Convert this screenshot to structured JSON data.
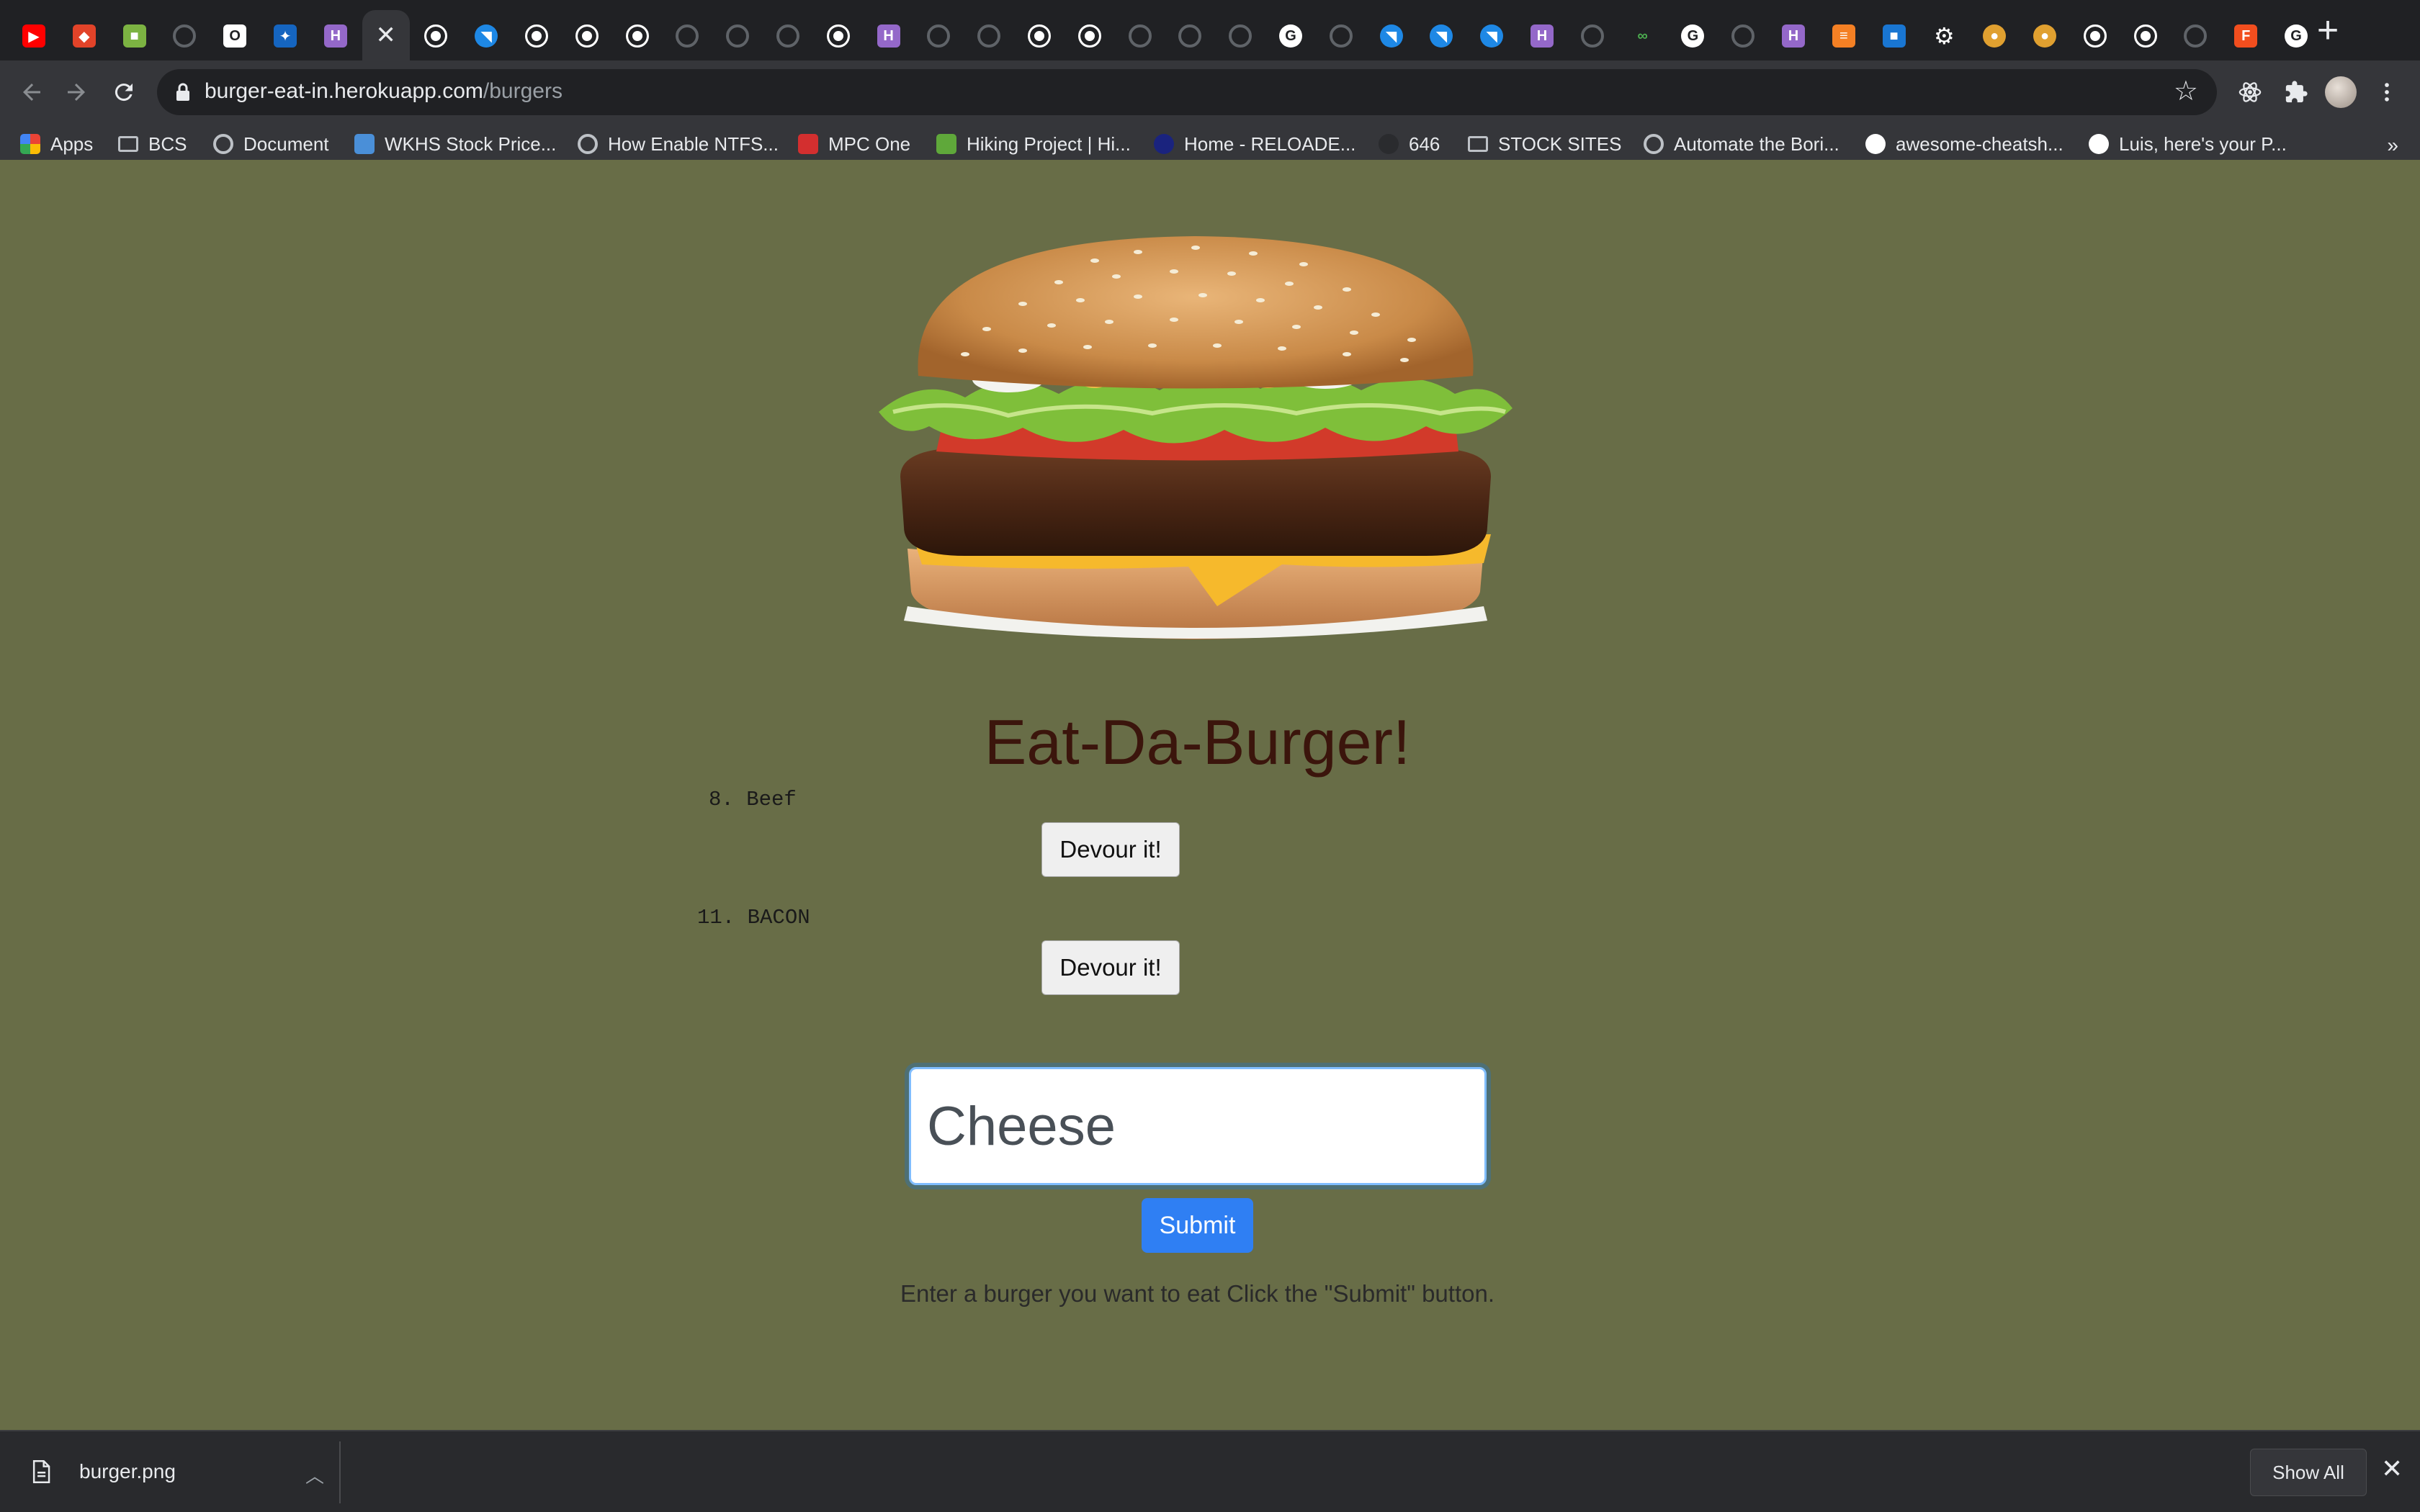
{
  "browser": {
    "tabs": [
      {
        "icon": "youtube-icon",
        "color": "#ff0000"
      },
      {
        "icon": "gitlab-icon",
        "color": "#e24329"
      },
      {
        "icon": "cube-icon",
        "color": "#7cb342"
      },
      {
        "icon": "globe-icon"
      },
      {
        "icon": "outlook-icon",
        "color": "#ffffff"
      },
      {
        "icon": "blue-square-icon",
        "color": "#1565c0"
      },
      {
        "icon": "heroku-icon",
        "color": "#9468c9"
      },
      {
        "icon": "close-icon",
        "active": true
      },
      {
        "icon": "github-icon"
      },
      {
        "icon": "blue-circle-icon",
        "color": "#1e88e5"
      },
      {
        "icon": "github-icon"
      },
      {
        "icon": "github-icon"
      },
      {
        "icon": "github-icon"
      },
      {
        "icon": "globe-icon"
      },
      {
        "icon": "globe-icon"
      },
      {
        "icon": "globe-icon"
      },
      {
        "icon": "github-icon"
      },
      {
        "icon": "heroku-icon",
        "color": "#9468c9"
      },
      {
        "icon": "globe-icon"
      },
      {
        "icon": "globe-icon"
      },
      {
        "icon": "github-icon"
      },
      {
        "icon": "github-icon"
      },
      {
        "icon": "globe-icon"
      },
      {
        "icon": "globe-icon"
      },
      {
        "icon": "globe-icon"
      },
      {
        "icon": "google-icon",
        "color": "#ffffff"
      },
      {
        "icon": "globe-icon"
      },
      {
        "icon": "blue-circle-icon",
        "color": "#1e88e5"
      },
      {
        "icon": "blue-circle-icon",
        "color": "#1e88e5"
      },
      {
        "icon": "blue-circle-icon",
        "color": "#1e88e5"
      },
      {
        "icon": "heroku-icon",
        "color": "#9468c9"
      },
      {
        "icon": "globe-icon"
      },
      {
        "icon": "infinity-icon",
        "color": "#4caf50"
      },
      {
        "icon": "google-icon",
        "color": "#ffffff"
      },
      {
        "icon": "globe-icon"
      },
      {
        "icon": "heroku-icon",
        "color": "#9468c9"
      },
      {
        "icon": "stackoverflow-icon",
        "color": "#f48024"
      },
      {
        "icon": "cube-icon",
        "color": "#1976d2"
      },
      {
        "icon": "gear-icon",
        "color": "#ffffff"
      },
      {
        "icon": "burger-icon",
        "color": "#e0a030"
      },
      {
        "icon": "burger-icon",
        "color": "#e0a030"
      },
      {
        "icon": "github-icon"
      },
      {
        "icon": "github-icon"
      },
      {
        "icon": "globe-icon"
      },
      {
        "icon": "figma-icon",
        "color": "#f24e1e"
      },
      {
        "icon": "google-icon",
        "color": "#ffffff"
      }
    ],
    "url_host": "burger-eat-in.herokuapp.com",
    "url_path": "/burgers",
    "bookmarks": [
      {
        "label": "Apps",
        "icon": "apps-grid-icon"
      },
      {
        "label": "BCS",
        "icon": "folder-icon"
      },
      {
        "label": "Document",
        "icon": "globe-icon"
      },
      {
        "label": "WKHS Stock Price...",
        "icon": "chart-icon"
      },
      {
        "label": "How Enable NTFS...",
        "icon": "globe-icon"
      },
      {
        "label": "MPC One",
        "icon": "akai-icon"
      },
      {
        "label": "Hiking Project | Hi...",
        "icon": "hiking-icon"
      },
      {
        "label": "Home - RELOADE...",
        "icon": "reload-icon"
      },
      {
        "label": "646",
        "icon": "dark-circle-icon"
      },
      {
        "label": "STOCK SITES",
        "icon": "folder-icon"
      },
      {
        "label": "Automate the Bori...",
        "icon": "globe-icon"
      },
      {
        "label": "awesome-cheatsh...",
        "icon": "github-icon"
      },
      {
        "label": "Luis, here's your P...",
        "icon": "google-icon"
      }
    ],
    "bookmarks_more": "»"
  },
  "page": {
    "title": "Eat-Da-Burger!",
    "burgers": [
      {
        "number": "8.",
        "name": "Beef",
        "button_label": "Devour it!"
      },
      {
        "number": "11.",
        "name": "BACON",
        "button_label": "Devour it!"
      }
    ],
    "input_value": "Cheese",
    "submit_label": "Submit",
    "instructions": "Enter a burger you want to eat Click the \"Submit\" button."
  },
  "download_shelf": {
    "file_name": "burger.png",
    "show_all_label": "Show All"
  }
}
